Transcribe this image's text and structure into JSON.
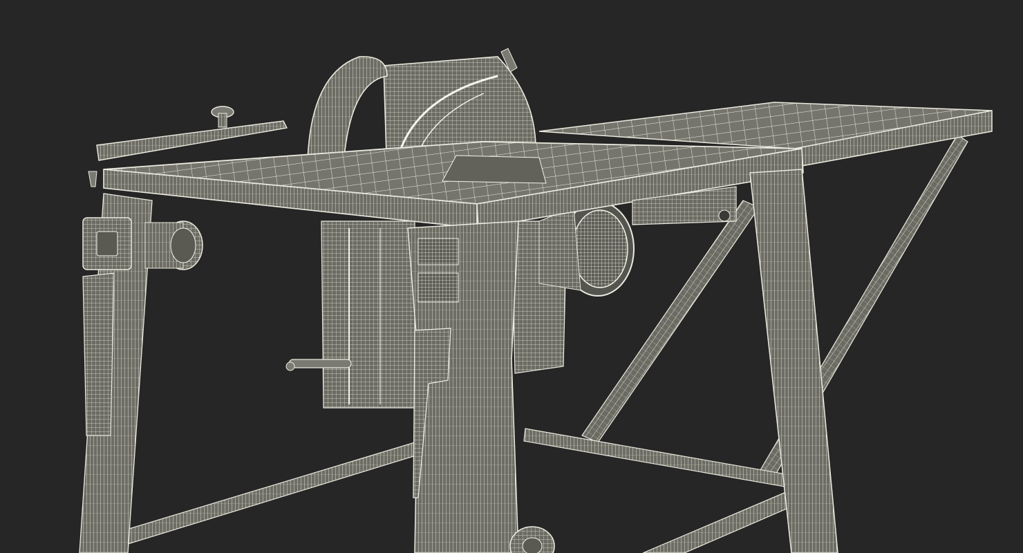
{
  "scene": {
    "subject": "table-saw-wireframe",
    "background_color": "#262626",
    "wire_color": "#ecebe0",
    "surface_color": "#6f6f67",
    "shadow_color": "#4f4f49"
  }
}
